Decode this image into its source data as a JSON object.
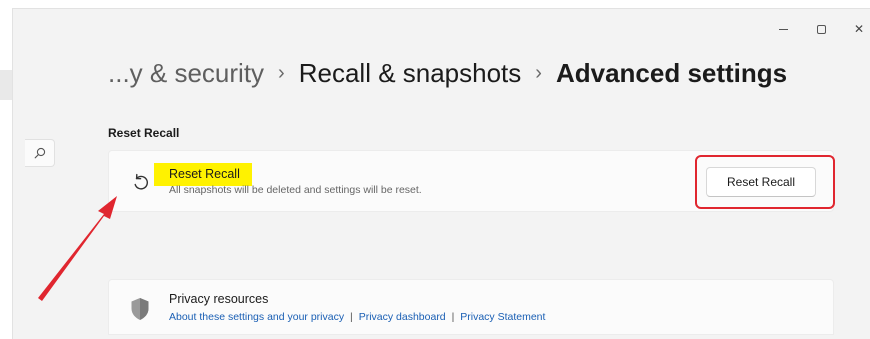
{
  "window": {
    "controls": {
      "minimize_icon": "minimize-icon",
      "maximize_icon": "maximize-icon",
      "close_icon": "close-icon",
      "close_glyph": "✕"
    }
  },
  "search": {
    "icon": "search-icon"
  },
  "breadcrumb": {
    "items": [
      {
        "label": "...y & security"
      },
      {
        "label": "Recall & snapshots"
      },
      {
        "label": "Advanced settings"
      }
    ],
    "separator": "›"
  },
  "reset_section": {
    "title": "Reset Recall",
    "card": {
      "icon": "reset-arrow-icon",
      "title": "Reset Recall",
      "description": "All snapshots will be deleted and settings will be reset.",
      "button_label": "Reset Recall",
      "highlight_color": "#fff200",
      "frame_color": "#e0262f"
    }
  },
  "privacy": {
    "icon": "shield-icon",
    "title": "Privacy resources",
    "links": [
      "About these settings and your privacy",
      "Privacy dashboard",
      "Privacy Statement"
    ],
    "separator": "|"
  },
  "annotation": {
    "arrow_color": "#e0262f"
  }
}
